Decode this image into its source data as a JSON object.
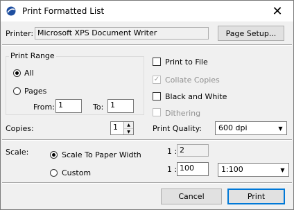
{
  "window": {
    "title": "Print Formatted List"
  },
  "icons": {
    "app": "app-logo-icon",
    "close": "close-icon"
  },
  "printer": {
    "label": "Printer:",
    "value": "Microsoft XPS Document Writer",
    "setup_button": "Page Setup..."
  },
  "print_range": {
    "title": "Print Range",
    "all_label": "All",
    "pages_label": "Pages",
    "all_selected": true,
    "from_label": "From:",
    "from_value": "1",
    "to_label": "To:",
    "to_value": "1"
  },
  "options": {
    "print_to_file": "Print to File",
    "collate_copies": "Collate Copies",
    "black_and_white": "Black and White",
    "dithering": "Dithering",
    "collate_checked": true
  },
  "copies": {
    "label": "Copies:",
    "value": "1"
  },
  "quality": {
    "label": "Print Quality:",
    "value": "600 dpi"
  },
  "scale": {
    "label": "Scale:",
    "fit_label": "Scale To Paper Width",
    "custom_label": "Custom",
    "fit_selected": true,
    "ratio_prefix_1": "1 :",
    "ratio_value_1": "2",
    "ratio_prefix_2": "1 :",
    "ratio_value_2": "100",
    "preset": "1:100"
  },
  "buttons": {
    "cancel": "Cancel",
    "print": "Print"
  }
}
